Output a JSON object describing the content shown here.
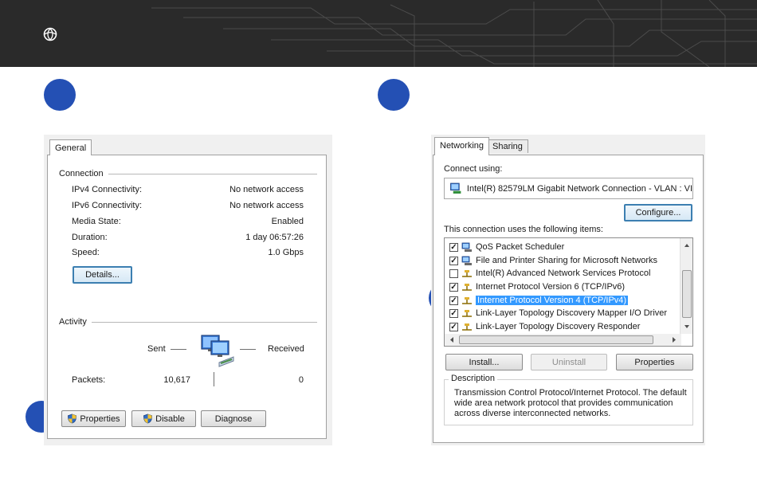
{
  "colors": {
    "banner": "#2a2a2a",
    "step_marker": "#2450b4",
    "selection": "#3399ff",
    "focus_border": "#3c7fb1"
  },
  "icons": [
    "logo-icon",
    "shield-icon",
    "network-computers-icon",
    "adapter-icon",
    "protocol-icon",
    "service-icon",
    "scroll-up-icon",
    "scroll-down-icon",
    "scroll-left-icon",
    "scroll-right-icon"
  ],
  "status_dialog": {
    "tab": "General",
    "connection": {
      "title": "Connection",
      "rows": [
        {
          "label": "IPv4 Connectivity:",
          "value": "No network access"
        },
        {
          "label": "IPv6 Connectivity:",
          "value": "No network access"
        },
        {
          "label": "Media State:",
          "value": "Enabled"
        },
        {
          "label": "Duration:",
          "value": "1 day 06:57:26"
        },
        {
          "label": "Speed:",
          "value": "1.0 Gbps"
        }
      ],
      "details_button": "Details..."
    },
    "activity": {
      "title": "Activity",
      "sent_label": "Sent",
      "received_label": "Received",
      "packets_label": "Packets:",
      "packets_sent": "10,617",
      "packets_received": "0"
    },
    "buttons": {
      "properties": "Properties",
      "disable": "Disable",
      "diagnose": "Diagnose"
    }
  },
  "properties_dialog": {
    "tabs": [
      "Networking",
      "Sharing"
    ],
    "connect_using_label": "Connect using:",
    "adapter": "Intel(R) 82579LM Gigabit Network Connection - VLAN : VI",
    "configure_button": "Configure...",
    "items_label": "This connection uses the following items:",
    "items": [
      {
        "checked": true,
        "label": "QoS Packet Scheduler",
        "icon": "service-icon",
        "selected": false
      },
      {
        "checked": true,
        "label": "File and Printer Sharing for Microsoft Networks",
        "icon": "service-icon",
        "selected": false
      },
      {
        "checked": false,
        "label": "Intel(R) Advanced Network Services Protocol",
        "icon": "protocol-icon",
        "selected": false
      },
      {
        "checked": true,
        "label": "Internet Protocol Version 6 (TCP/IPv6)",
        "icon": "protocol-icon",
        "selected": false
      },
      {
        "checked": true,
        "label": "Internet Protocol Version 4 (TCP/IPv4)",
        "icon": "protocol-icon",
        "selected": true
      },
      {
        "checked": true,
        "label": "Link-Layer Topology Discovery Mapper I/O Driver",
        "icon": "protocol-icon",
        "selected": false
      },
      {
        "checked": true,
        "label": "Link-Layer Topology Discovery Responder",
        "icon": "protocol-icon",
        "selected": false
      }
    ],
    "buttons": {
      "install": "Install...",
      "uninstall": "Uninstall",
      "properties": "Properties"
    },
    "description_title": "Description",
    "description_lines": [
      "Transmission Control Protocol/Internet Protocol. The default",
      "wide area network protocol that provides communication",
      "across diverse interconnected networks."
    ]
  }
}
